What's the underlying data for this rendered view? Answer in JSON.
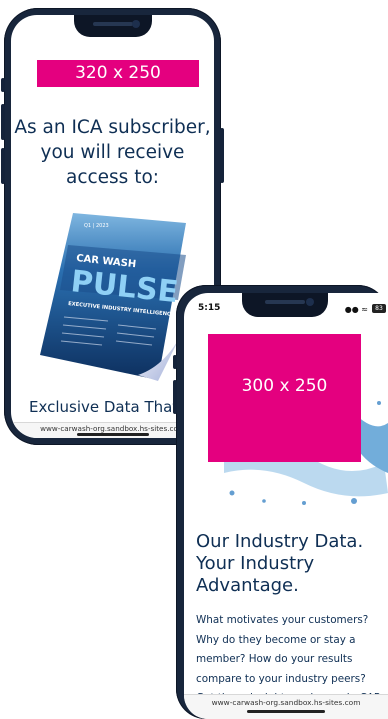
{
  "phone_left": {
    "ad_placeholder": "320 x 250",
    "heading": "As an ICA subscriber, you will receive access to:",
    "magazine": {
      "issue": "Q1 | 2023",
      "title_small": "CAR WASH",
      "title_big": "PULSE",
      "tagline": "EXECUTIVE INDUSTRY INTELLIGENCE"
    },
    "subheading": "Exclusive Data That Drives Decisions",
    "url": "www-carwash-org.sandbox.hs-sites.com"
  },
  "phone_right": {
    "status": {
      "time": "5:15",
      "battery": "83"
    },
    "ad_placeholder": "300 x 250",
    "heading": "Our Industry Data. Your Industry Advantage.",
    "body": "What motivates your customers? Why do they become or stay a member? How do your results compare to your industry peers? Get these insights and more in CAR",
    "url": "www-carwash-org.sandbox.hs-sites.com"
  },
  "colors": {
    "frame": "#18263c",
    "ad": "#e4007f",
    "heading": "#0f2f54"
  }
}
